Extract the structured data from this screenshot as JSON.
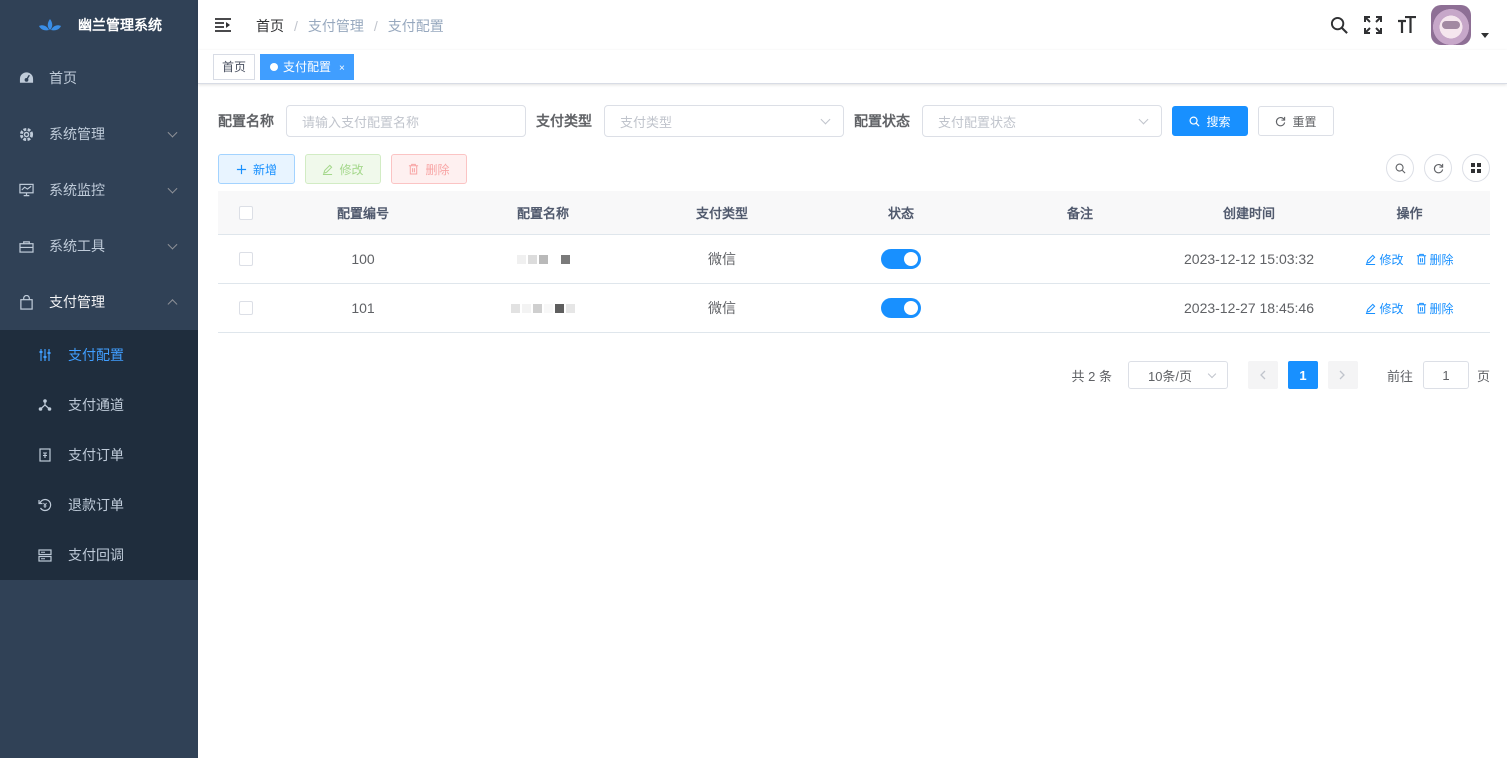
{
  "app": {
    "title": "幽兰管理系统"
  },
  "sidebar": {
    "items": [
      {
        "label": "首页",
        "icon": "dashboard-icon"
      },
      {
        "label": "系统管理",
        "icon": "gear-icon"
      },
      {
        "label": "系统监控",
        "icon": "monitor-icon"
      },
      {
        "label": "系统工具",
        "icon": "toolbox-icon"
      },
      {
        "label": "支付管理",
        "icon": "shopping-bag-icon"
      }
    ],
    "sub_items": [
      {
        "label": "支付配置",
        "icon": "sliders-icon"
      },
      {
        "label": "支付通道",
        "icon": "share-icon"
      },
      {
        "label": "支付订单",
        "icon": "document-icon"
      },
      {
        "label": "退款订单",
        "icon": "refund-icon"
      },
      {
        "label": "支付回调",
        "icon": "server-icon"
      }
    ]
  },
  "breadcrumb": {
    "home": "首页",
    "level1": "支付管理",
    "level2": "支付配置",
    "sep": "/"
  },
  "tags": {
    "home": "首页",
    "active": "支付配置",
    "close": "×"
  },
  "search": {
    "name_label": "配置名称",
    "name_placeholder": "请输入支付配置名称",
    "type_label": "支付类型",
    "type_placeholder": "支付类型",
    "status_label": "配置状态",
    "status_placeholder": "支付配置状态",
    "search_btn": "搜索",
    "reset_btn": "重置"
  },
  "toolbar": {
    "add": "新增",
    "edit": "修改",
    "delete": "删除"
  },
  "table": {
    "headers": {
      "id": "配置编号",
      "name": "配置名称",
      "type": "支付类型",
      "status": "状态",
      "remark": "备注",
      "time": "创建时间",
      "op": "操作"
    },
    "rows": [
      {
        "id": "100",
        "type": "微信",
        "status_on": true,
        "remark": "",
        "time": "2023-12-12 15:03:32",
        "edit": "修改",
        "delete": "删除"
      },
      {
        "id": "101",
        "type": "微信",
        "status_on": true,
        "remark": "",
        "time": "2023-12-27 18:45:46",
        "edit": "修改",
        "delete": "删除"
      }
    ]
  },
  "pagination": {
    "total": "共 2 条",
    "page_size": "10条/页",
    "current": "1",
    "goto_label": "前往",
    "goto_value": "1",
    "page_suffix": "页"
  },
  "colors": {
    "sidebar_bg": "#304156",
    "submenu_bg": "#1f2d3d",
    "accent": "#1890ff"
  }
}
